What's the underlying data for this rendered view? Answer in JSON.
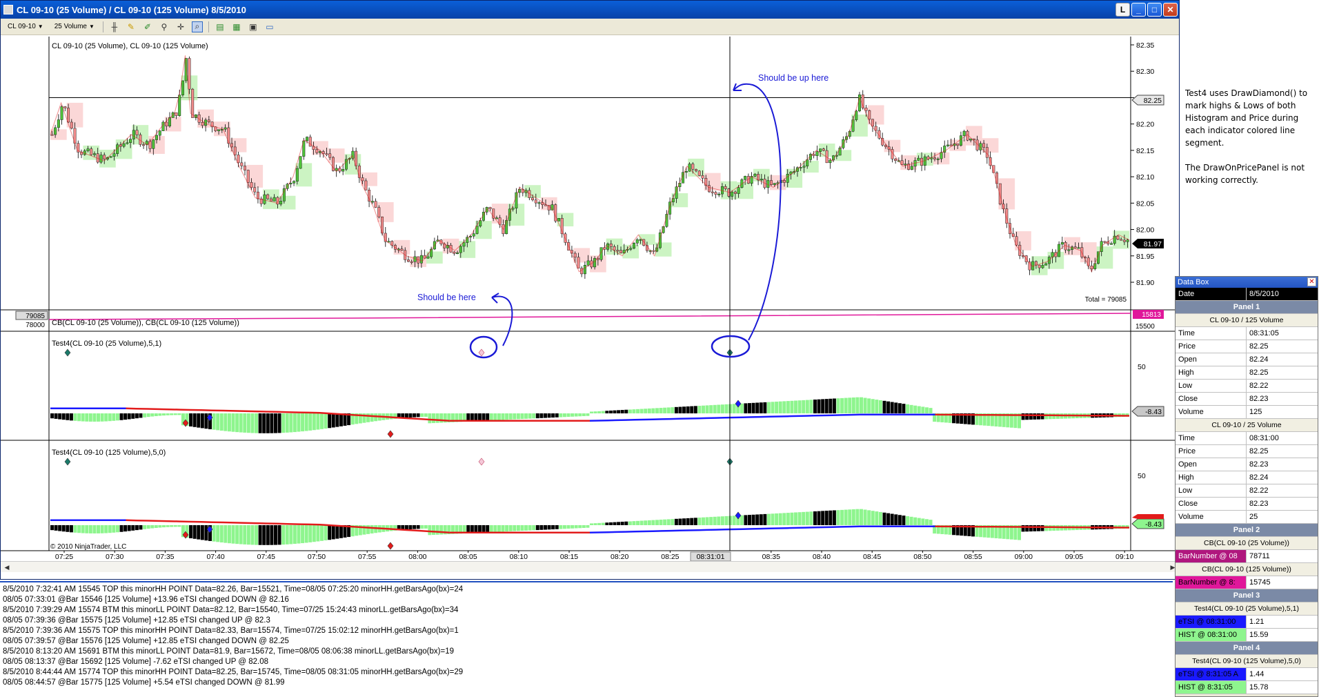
{
  "window": {
    "title": "CL 09-10 (25 Volume) / CL 09-10 (125 Volume)  8/5/2010",
    "buttons": {
      "l": "L",
      "minimize": "_",
      "maximize": "□",
      "close": "✕"
    }
  },
  "toolbar": {
    "instrument": "CL 09-10",
    "period": "25 Volume"
  },
  "panel1": {
    "label": "CL 09-10 (25 Volume), CL 09-10 (125 Volume)",
    "price_axis": [
      "82.35",
      "82.30",
      "82.25",
      "82.20",
      "82.15",
      "82.10",
      "82.05",
      "82.00",
      "81.95",
      "81.90"
    ],
    "marker_high": "82.25",
    "marker_last": "81.97",
    "total_label": "Total = 79085"
  },
  "panel2": {
    "label": "CB(CL 09-10 (25 Volume)), CB(CL 09-10 (125 Volume))",
    "left_value_top": "79085",
    "left_value_bottom": "78000",
    "right_value": "15813",
    "right_axis": "15500"
  },
  "panel3": {
    "label": "Test4(CL 09-10 (25 Volume),5,1)",
    "axis": "50",
    "marker_value": "-8.43"
  },
  "panel4": {
    "label": "Test4(CL 09-10 (125 Volume),5,0)",
    "axis": "50",
    "marker_value": "-8.43",
    "copyright": "© 2010 NinjaTrader, LLC"
  },
  "time_axis": [
    "07:25",
    "07:30",
    "07:35",
    "07:40",
    "07:45",
    "07:50",
    "07:55",
    "08:00",
    "08:05",
    "08:10",
    "08:15",
    "08:20",
    "08:25",
    "08:35",
    "08:40",
    "08:45",
    "08:50",
    "08:55",
    "09:00",
    "09:05",
    "09:10"
  ],
  "cursor_time": "08:31:01",
  "annotations": {
    "up": "Should be up here",
    "down": "Should be here"
  },
  "side_note": [
    "Test4 uses DrawDiamond() to mark highs & Lows of both Histogram and Price during each indicator colored line segment.",
    "The DrawOnPricePanel is not working correctly."
  ],
  "output_log": [
    "8/5/2010 7:32:41 AM 15545 TOP this minorHH  POINT Data=82.26, Bar=15521, Time=08/05  07:25:20 minorHH.getBarsAgo(bx)=24",
    "08/05 07:33:01 @Bar 15546 [125 Volume] +13.96 eTSI changed DOWN @ 82.16",
    "8/5/2010 7:39:29 AM 15574 BTM this minorLL  POINT Data=82.12, Bar=15540, Time=07/25  15:24:43 minorLL.getBarsAgo(bx)=34",
    "08/05 07:39:36 @Bar 15575 [125 Volume] +12.85 eTSI changed UP @ 82.3",
    "8/5/2010 7:39:36 AM 15575 TOP this minorHH  POINT Data=82.33, Bar=15574, Time=07/25  15:02:12 minorHH.getBarsAgo(bx)=1",
    "08/05 07:39:57 @Bar 15576 [125 Volume] +12.85 eTSI changed DOWN @ 82.25",
    "8/5/2010 8:13:20 AM 15691 BTM this minorLL  POINT Data=81.9, Bar=15672, Time=08/05  08:06:38 minorLL.getBarsAgo(bx)=19",
    "08/05 08:13:37 @Bar 15692 [125 Volume] -7.62 eTSI changed UP @ 82.08",
    "8/5/2010 8:44:44 AM 15774 TOP this minorHH  POINT Data=82.25, Bar=15745, Time=08/05  08:31:05 minorHH.getBarsAgo(bx)=29",
    "08/05 08:44:57 @Bar 15775 [125 Volume] +5.54 eTSI changed DOWN @ 81.99"
  ],
  "databox": {
    "title": "Data Box",
    "date_label": "Date",
    "date_value": "8/5/2010",
    "panel1_title": "Panel 1",
    "series125_title": "CL 09-10 / 125 Volume",
    "series125": [
      {
        "k": "Time",
        "v": "08:31:05"
      },
      {
        "k": "Price",
        "v": "82.25"
      },
      {
        "k": "Open",
        "v": "82.24"
      },
      {
        "k": "High",
        "v": "82.25"
      },
      {
        "k": "Low",
        "v": "82.22"
      },
      {
        "k": "Close",
        "v": "82.23"
      },
      {
        "k": "Volume",
        "v": "125"
      }
    ],
    "series25_title": "CL 09-10 / 25 Volume",
    "series25": [
      {
        "k": "Time",
        "v": "08:31:00"
      },
      {
        "k": "Price",
        "v": "82.25"
      },
      {
        "k": "Open",
        "v": "82.23"
      },
      {
        "k": "High",
        "v": "82.24"
      },
      {
        "k": "Low",
        "v": "82.22"
      },
      {
        "k": "Close",
        "v": "82.23"
      },
      {
        "k": "Volume",
        "v": "25"
      }
    ],
    "panel2_title": "Panel 2",
    "cb25_title": "CB(CL 09-10 (25 Volume))",
    "cb25_key": "BarNumber @ 08",
    "cb25_value": "78711",
    "cb125_title": "CB(CL 09-10 (125 Volume))",
    "cb125_key": "BarNumber @ 8:",
    "cb125_value": "15745",
    "panel3_title": "Panel 3",
    "t4a_title": "Test4(CL 09-10 (25 Volume),5,1)",
    "t4a_rows": [
      {
        "k": "eTSI @ 08:31:00",
        "v": "1.21"
      },
      {
        "k": "HIST @ 08:31:00",
        "v": "15.59"
      }
    ],
    "panel4_title": "Panel 4",
    "t4b_title": "Test4(CL 09-10 (125 Volume),5,0)",
    "t4b_rows": [
      {
        "k": "eTSI @ 8:31:05 A",
        "v": "1.44"
      },
      {
        "k": "HIST @ 8:31:05",
        "v": "15.78"
      }
    ]
  },
  "colors": {
    "up_bar": "#7ddc6a",
    "down_bar": "#f4a7a7",
    "line_up": "#1a1aff",
    "line_down": "#e21b1b",
    "hist_pos": "#8ef58e",
    "hist_neg": "#000000",
    "annotation": "#1a1ad6"
  }
}
